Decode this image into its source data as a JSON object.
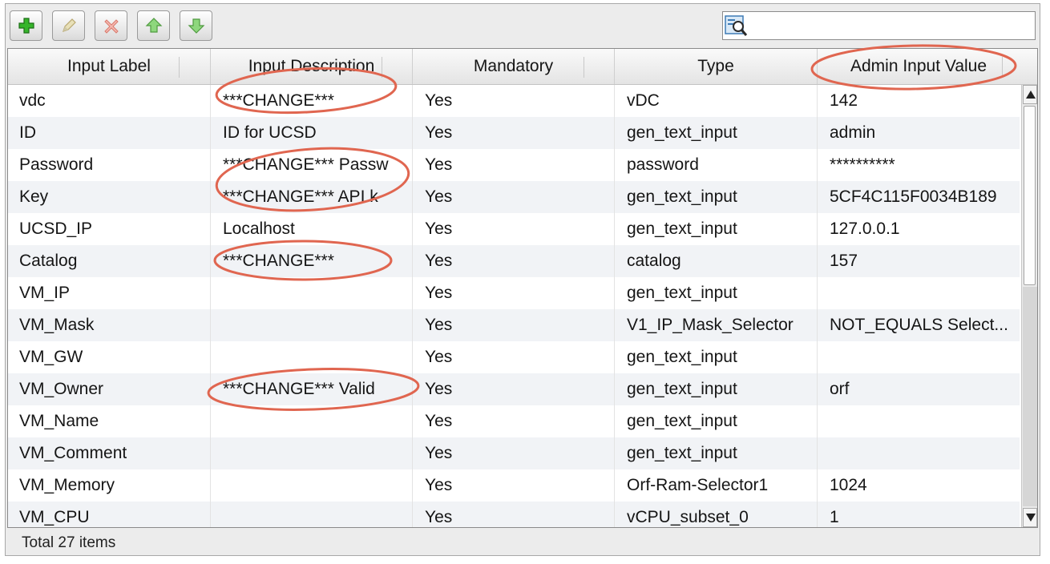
{
  "toolbar": {
    "buttons": [
      {
        "name": "add",
        "icon": "plus-icon"
      },
      {
        "name": "edit",
        "icon": "pencil-icon"
      },
      {
        "name": "delete",
        "icon": "delete-x-icon"
      },
      {
        "name": "move-up",
        "icon": "arrow-up-icon"
      },
      {
        "name": "move-down",
        "icon": "arrow-down-icon"
      }
    ],
    "search": {
      "icon": "search-filter-icon",
      "value": ""
    }
  },
  "grid": {
    "columns": [
      "Input Label",
      "Input Description",
      "Mandatory",
      "Type",
      "Admin Input Value"
    ],
    "rows": [
      {
        "label": "vdc",
        "description": "***CHANGE***",
        "mandatory": "Yes",
        "type": "vDC",
        "value": "142"
      },
      {
        "label": "ID",
        "description": "ID for UCSD",
        "mandatory": "Yes",
        "type": "gen_text_input",
        "value": "admin"
      },
      {
        "label": "Password",
        "description": "***CHANGE*** Passw",
        "mandatory": "Yes",
        "type": "password",
        "value": "**********"
      },
      {
        "label": "Key",
        "description": "***CHANGE*** API k",
        "mandatory": "Yes",
        "type": "gen_text_input",
        "value": "5CF4C115F0034B189"
      },
      {
        "label": "UCSD_IP",
        "description": "Localhost",
        "mandatory": "Yes",
        "type": "gen_text_input",
        "value": "127.0.0.1"
      },
      {
        "label": "Catalog",
        "description": "***CHANGE***",
        "mandatory": "Yes",
        "type": "catalog",
        "value": "157"
      },
      {
        "label": "VM_IP",
        "description": "",
        "mandatory": "Yes",
        "type": "gen_text_input",
        "value": ""
      },
      {
        "label": "VM_Mask",
        "description": "",
        "mandatory": "Yes",
        "type": "V1_IP_Mask_Selector",
        "value": "NOT_EQUALS Select..."
      },
      {
        "label": "VM_GW",
        "description": "",
        "mandatory": "Yes",
        "type": "gen_text_input",
        "value": ""
      },
      {
        "label": "VM_Owner",
        "description": "***CHANGE*** Valid",
        "mandatory": "Yes",
        "type": "gen_text_input",
        "value": "orf"
      },
      {
        "label": "VM_Name",
        "description": "",
        "mandatory": "Yes",
        "type": "gen_text_input",
        "value": ""
      },
      {
        "label": "VM_Comment",
        "description": "",
        "mandatory": "Yes",
        "type": "gen_text_input",
        "value": ""
      },
      {
        "label": "VM_Memory",
        "description": "",
        "mandatory": "Yes",
        "type": "Orf-Ram-Selector1",
        "value": "1024"
      },
      {
        "label": "VM_CPU",
        "description": "",
        "mandatory": "Yes",
        "type": "vCPU_subset_0",
        "value": "1"
      }
    ]
  },
  "footer": {
    "status": "Total 27 items"
  },
  "colors": {
    "annotation": "#e06650",
    "row_alt": "#f1f3f6"
  }
}
